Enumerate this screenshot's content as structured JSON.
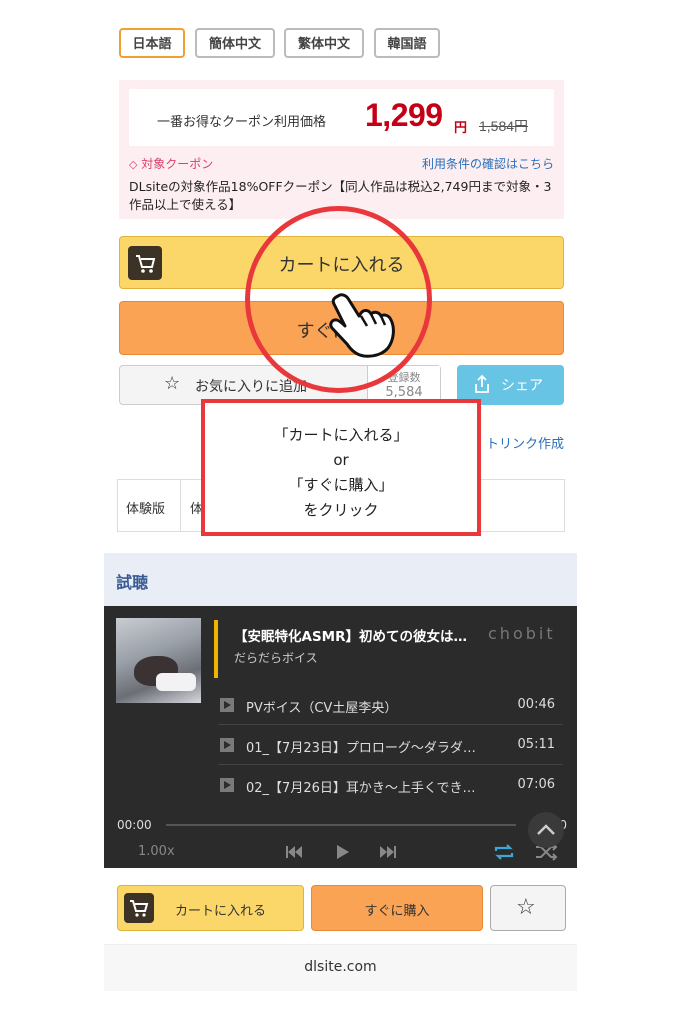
{
  "language_tabs": [
    "日本語",
    "簡体中文",
    "繁体中文",
    "韓国語"
  ],
  "coupon": {
    "price_label": "一番お得なクーポン利用価格",
    "price": "1,299",
    "price_unit": "円",
    "original_price": "1,584円",
    "tag": "対象クーポン",
    "terms_link": "利用条件の確認はこちら",
    "description": "DLsiteの対象作品18%OFFクーポン【同人作品は税込2,749円まで対象・3作品以上で使える】"
  },
  "buttons": {
    "add_to_cart": "カートに入れる",
    "buy_now": "すぐに購入",
    "favorite": "お気に入りに追加",
    "favorite_count_label": "登録数",
    "favorite_count": "5,584",
    "share": "シェア"
  },
  "affiliate_link": "トリンク作成",
  "trial": {
    "label": "体験版",
    "value": "体"
  },
  "annotation": {
    "line1": "「カートに入れる」",
    "line2": "or",
    "line3": "「すぐに購入」",
    "line4": "をクリック"
  },
  "listen": {
    "heading": "試聴",
    "title": "【安眠特化ASMR】初めての彼女は…",
    "brand": "chobit",
    "circle": "だらだらボイス",
    "tracks": [
      {
        "name": "PVボイス（CV土屋李央）",
        "duration": "00:46"
      },
      {
        "name": "01_【7月23日】プロローグ〜ダラダ…",
        "duration": "05:11"
      },
      {
        "name": "02_【7月26日】耳かき〜上手くでき…",
        "duration": "07:06"
      }
    ],
    "time_current": "00:00",
    "time_total": "00:00",
    "speed": "1.00x"
  },
  "bottom_bar": {
    "add_to_cart": "カートに入れる",
    "buy_now": "すぐに購入"
  },
  "url": "dlsite.com",
  "colors": {
    "price_red": "#c40017",
    "annotation_red": "#e8383b",
    "cart_yellow": "#fbd76a",
    "buy_orange": "#fba355",
    "share_blue": "#68c4e4"
  }
}
